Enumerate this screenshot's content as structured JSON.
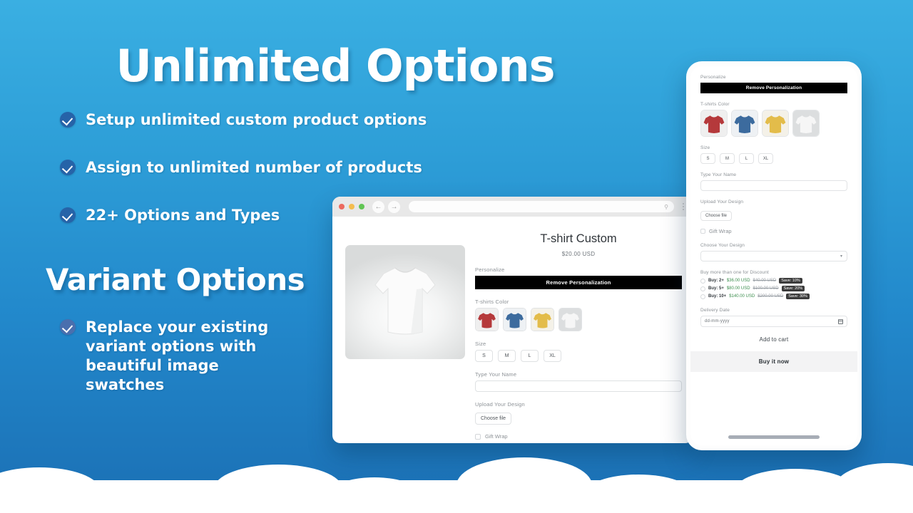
{
  "theme": {
    "bg_top": "#3aafe2",
    "bg_bottom": "#1b6fb4",
    "cloud": "#ffffff",
    "check_badge": "#2663a8",
    "accent_dark": "#000000",
    "price_new": "#3d8f4f",
    "price_old": "#9aa0a6",
    "save_badge": "#3c3c3c"
  },
  "hero": {
    "title": "Unlimited Options",
    "bullets": [
      {
        "icon": "check-circle-icon",
        "text": "Setup unlimited custom product options"
      },
      {
        "icon": "check-circle-icon",
        "text": "Assign to unlimited number of products"
      },
      {
        "icon": "check-circle-icon",
        "text": "22+ Options and Types"
      }
    ],
    "subtitle": "Variant Options",
    "sub_bullets": [
      {
        "icon": "check-circle-icon",
        "text": "Replace your existing variant options with beautiful image swatches"
      }
    ]
  },
  "browser": {
    "traffic_lights": [
      "close",
      "minimize",
      "maximize"
    ],
    "back_icon": "arrow-left-icon",
    "forward_icon": "arrow-right-icon",
    "url_value": "",
    "search_icon": "search-icon",
    "menu_icon": "kebab-menu-icon",
    "product": {
      "image_alt": "white t-shirt product photo",
      "title": "T-shirt Custom",
      "price": "$20.00 USD",
      "personalize_label": "Personalize",
      "personalize_button": "Remove Personalization",
      "color_label": "T-shirts Color",
      "colors": [
        {
          "name": "Red",
          "hex": "#b5393b"
        },
        {
          "name": "Blue",
          "hex": "#3c6b9e"
        },
        {
          "name": "Yellow",
          "hex": "#e3bc4a"
        },
        {
          "name": "White",
          "hex": "#e9eaea"
        }
      ],
      "size_label": "Size",
      "sizes": [
        "S",
        "M",
        "L",
        "XL"
      ],
      "name_label": "Type Your Name",
      "name_value": "",
      "upload_label": "Upload Your Design",
      "upload_button": "Choose file",
      "giftwrap_label": "Gift Wrap"
    }
  },
  "phone": {
    "personalize_label": "Personalize",
    "personalize_button": "Remove Personalization",
    "color_label": "T-shirts Color",
    "colors": [
      {
        "name": "Red",
        "hex": "#b5393b"
      },
      {
        "name": "Blue",
        "hex": "#3c6b9e"
      },
      {
        "name": "Yellow",
        "hex": "#e3bc4a"
      },
      {
        "name": "White",
        "hex": "#e9eaea"
      }
    ],
    "size_label": "Size",
    "sizes": [
      "S",
      "M",
      "L",
      "XL"
    ],
    "name_label": "Type Your Name",
    "name_value": "",
    "upload_label": "Upload Your Design",
    "upload_button": "Choose file",
    "giftwrap_label": "Gift Wrap",
    "design_label": "Choose Your Design",
    "design_value": "",
    "discount_label": "Buy more than one for Discount",
    "discounts": [
      {
        "qty": "Buy: 2+",
        "new_price": "$36.00 USD",
        "old_price": "$40.00 USD",
        "save": "Save: 10%"
      },
      {
        "qty": "Buy: 5+",
        "new_price": "$80.00 USD",
        "old_price": "$100.00 USD",
        "save": "Save: 20%"
      },
      {
        "qty": "Buy: 10+",
        "new_price": "$140.00 USD",
        "old_price": "$200.00 USD",
        "save": "Save: 30%"
      }
    ],
    "delivery_label": "Delivery Date",
    "delivery_value": "dd-mm-yyyy",
    "calendar_icon": "calendar-icon",
    "add_to_cart": "Add to cart",
    "buy_now": "Buy it now"
  }
}
